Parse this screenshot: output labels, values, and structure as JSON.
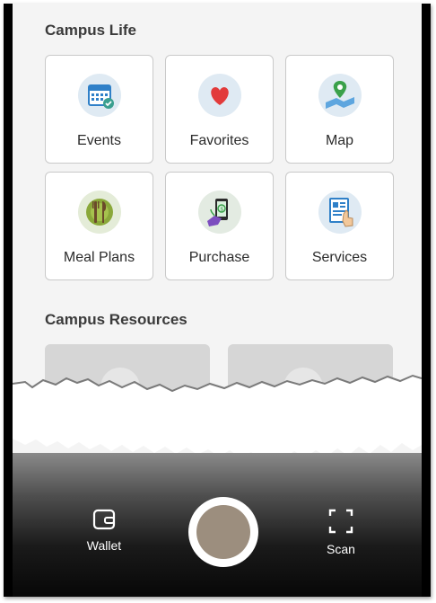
{
  "campus_life": {
    "title": "Campus Life",
    "tiles": [
      {
        "label": "Events",
        "icon": "calendar-icon"
      },
      {
        "label": "Favorites",
        "icon": "heart-icon"
      },
      {
        "label": "Map",
        "icon": "map-pin-icon"
      },
      {
        "label": "Meal Plans",
        "icon": "fork-knife-icon"
      },
      {
        "label": "Purchase",
        "icon": "phone-payment-icon"
      },
      {
        "label": "Services",
        "icon": "document-hand-icon"
      }
    ]
  },
  "campus_resources": {
    "title": "Campus Resources"
  },
  "bottom_nav": {
    "wallet_label": "Wallet",
    "scan_label": "Scan"
  },
  "colors": {
    "accent_blue": "#2f80c8",
    "heart_red": "#e23b3b",
    "map_green": "#3aa14a",
    "shutter_fill": "#9c8e7e"
  }
}
